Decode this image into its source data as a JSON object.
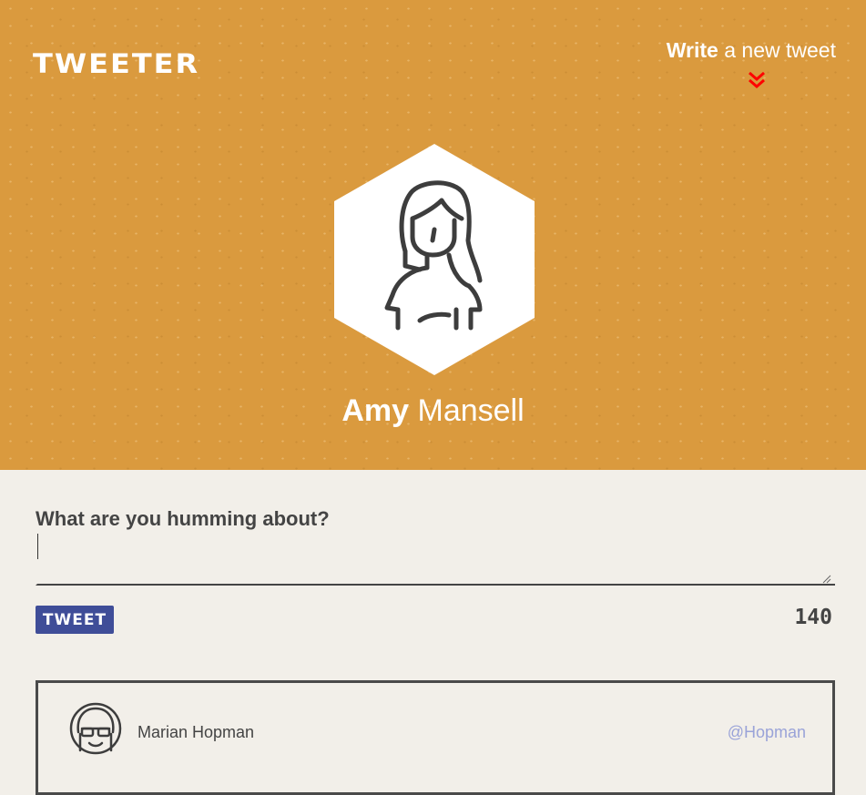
{
  "brand": {
    "logo": "TWEETER"
  },
  "header": {
    "write_bold": "Write",
    "write_rest": " a new tweet",
    "chevron_icon": "double-chevron-down-icon",
    "chevron_color": "#ff0000"
  },
  "profile": {
    "first_name": "Amy",
    "last_name": " Mansell",
    "avatar_icon": "person-avatar-icon"
  },
  "composer": {
    "label": "What are you humming about?",
    "value": "",
    "button_label": "TWEET",
    "char_count": "140"
  },
  "tweets": [
    {
      "author": "Marian Hopman",
      "handle": "@Hopman",
      "avatar_icon": "person-sunglasses-avatar-icon"
    }
  ],
  "colors": {
    "hero_bg": "#da9a3e",
    "page_bg": "#f2efe9",
    "button_bg": "#3f4d98",
    "handle": "#9aa3d8"
  }
}
